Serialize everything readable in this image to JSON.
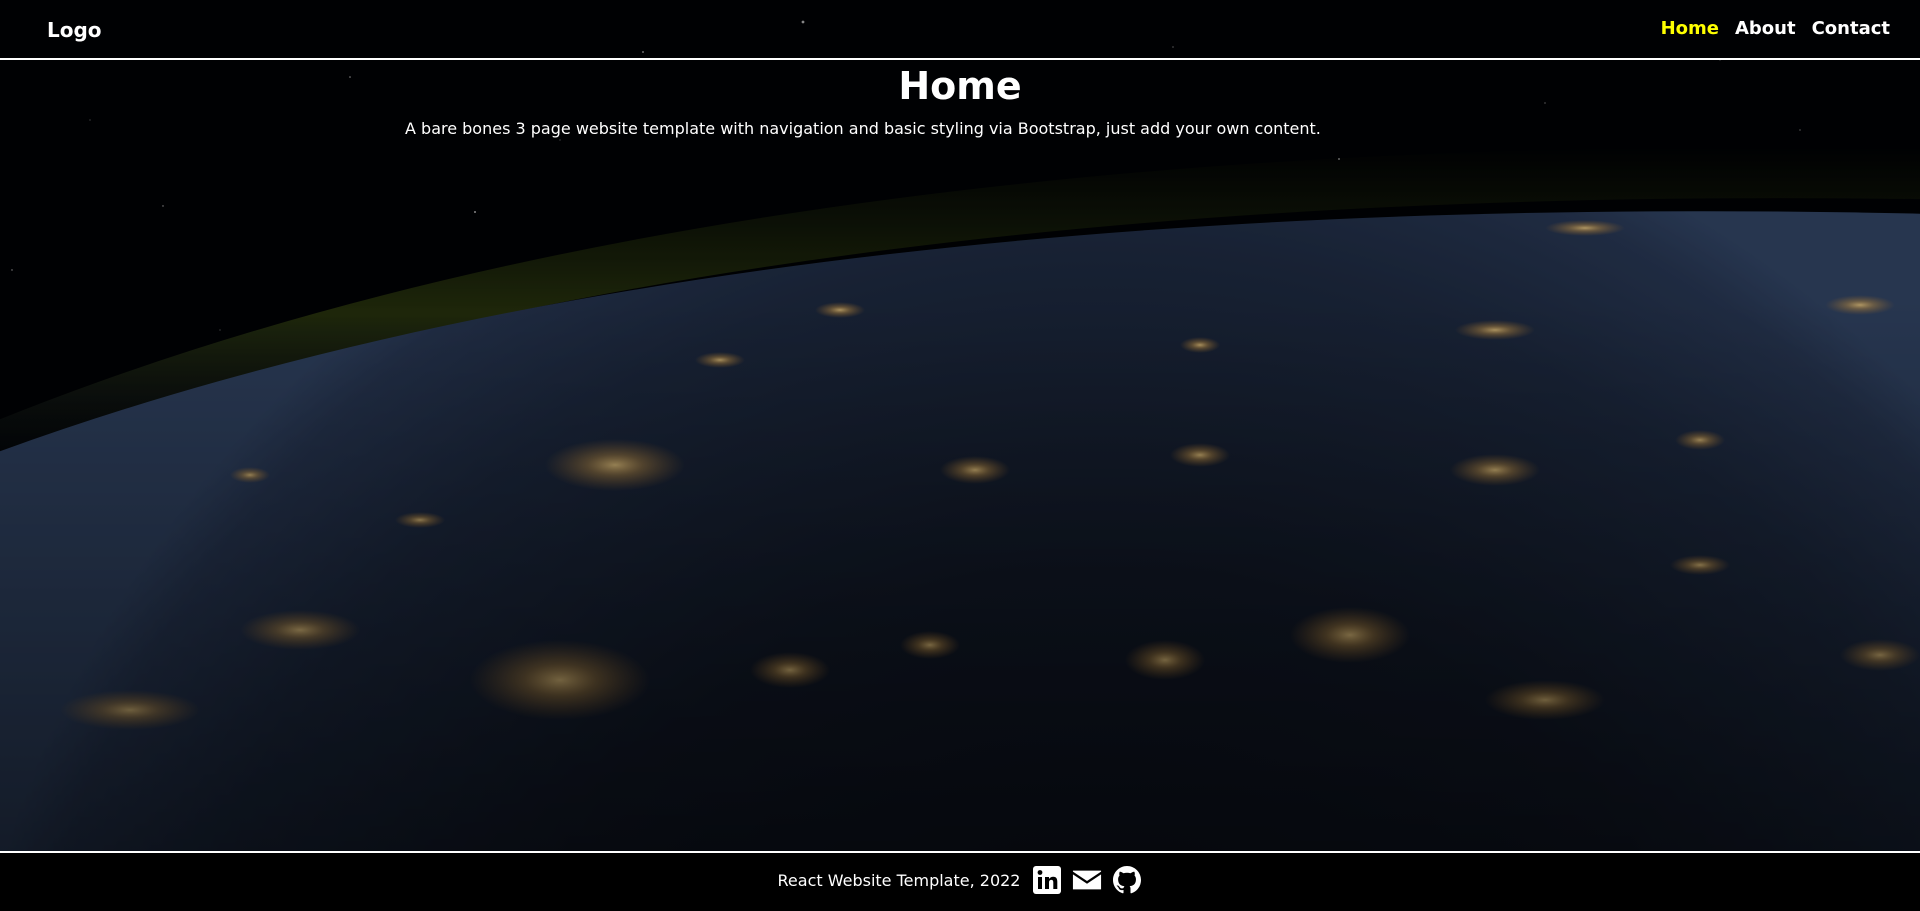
{
  "header": {
    "brand": "Logo",
    "nav": [
      {
        "label": "Home",
        "active": true
      },
      {
        "label": "About",
        "active": false
      },
      {
        "label": "Contact",
        "active": false
      }
    ],
    "active_color": "#ffff00"
  },
  "main": {
    "title": "Home",
    "description": "A bare bones 3 page website template with navigation and basic styling via Bootstrap, just add your own content."
  },
  "footer": {
    "text": "React Website Template, 2022",
    "social_icons": [
      "linkedin-icon",
      "envelope-icon",
      "github-icon"
    ]
  }
}
